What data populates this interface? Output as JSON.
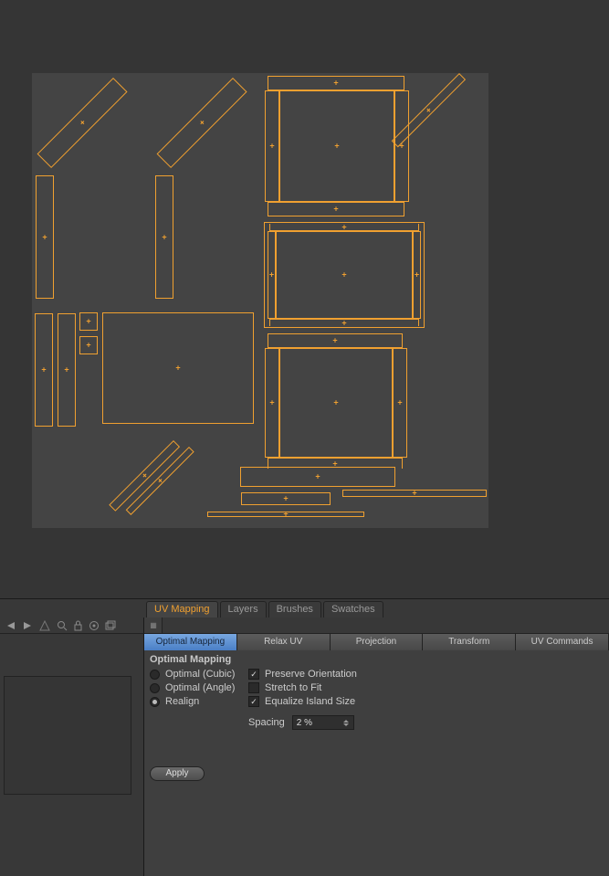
{
  "main_tabs": {
    "uv_mapping": "UV Mapping",
    "layers": "Layers",
    "brushes": "Brushes",
    "swatches": "Swatches"
  },
  "sub_tabs": {
    "optimal_mapping": "Optimal Mapping",
    "relax_uv": "Relax UV",
    "projection": "Projection",
    "transform": "Transform",
    "uv_commands": "UV Commands"
  },
  "panel": {
    "title": "Optimal Mapping",
    "radios": {
      "optimal_cubic": "Optimal (Cubic)",
      "optimal_angle": "Optimal (Angle)",
      "realign": "Realign"
    },
    "checks": {
      "preserve_orientation": "Preserve Orientation",
      "stretch_to_fit": "Stretch to Fit",
      "equalize_island_size": "Equalize Island Size"
    },
    "spacing_label": "Spacing",
    "spacing_value": "2 %",
    "apply": "Apply"
  }
}
